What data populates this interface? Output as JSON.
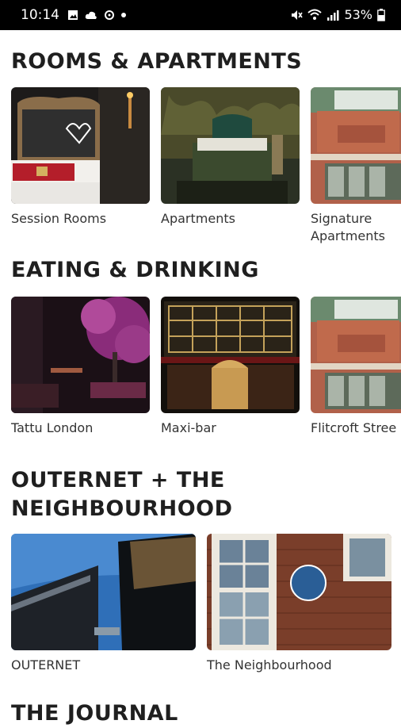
{
  "status_bar": {
    "time": "10:14",
    "battery": "53%"
  },
  "sections": [
    {
      "title": "ROOMS & APARTMENTS",
      "items": [
        {
          "label": "Session Rooms"
        },
        {
          "label": "Apartments"
        },
        {
          "label": "Signature Apartments"
        }
      ]
    },
    {
      "title": "EATING & DRINKING",
      "items": [
        {
          "label": "Tattu London"
        },
        {
          "label": "Maxi-bar"
        },
        {
          "label": "Flitcroft Stree"
        }
      ]
    },
    {
      "title": "OUTERNET + THE NEIGHBOURHOOD",
      "items": [
        {
          "label": "OUTERNET"
        },
        {
          "label": "The Neighbourhood"
        }
      ]
    },
    {
      "title": "THE JOURNAL"
    }
  ]
}
